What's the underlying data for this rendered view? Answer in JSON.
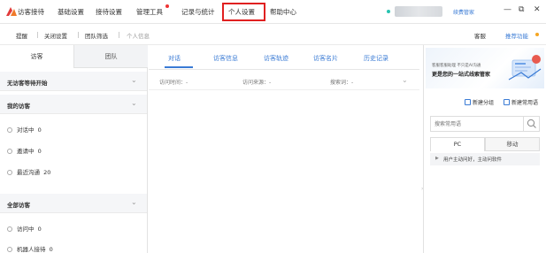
{
  "menu": {
    "items": [
      {
        "label": "访客接待"
      },
      {
        "label": "基础设置"
      },
      {
        "label": "接待设置"
      },
      {
        "label": "管理工具"
      },
      {
        "label": "记录与统计"
      },
      {
        "label": "个人设置"
      },
      {
        "label": "帮助中心"
      }
    ],
    "highlight_color": "#e02020",
    "notification_color": "#e33333"
  },
  "account": {
    "link": "续费管家",
    "status_color": "#29c3b0"
  },
  "window_controls": {
    "minimize": "—",
    "restore": "⧉",
    "close": "✕"
  },
  "toolbar": {
    "items": [
      {
        "label": "提醒"
      },
      {
        "label": "关闭设置"
      },
      {
        "label": "团队筛选"
      },
      {
        "label": "个人信息"
      }
    ],
    "right_plain": "客服",
    "right_link": "推荐功能"
  },
  "left_panel": {
    "tabs": [
      {
        "label": "访客"
      },
      {
        "label": "团队"
      }
    ],
    "groups": {
      "waiting": {
        "title": "无访客等待开始"
      },
      "mine": {
        "title": "我的访客",
        "items": [
          {
            "label": "对话中",
            "count": "0"
          },
          {
            "label": "邀请中",
            "count": "0"
          },
          {
            "label": "最近沟通",
            "count": "20"
          }
        ]
      },
      "all": {
        "title": "全部访客",
        "items": [
          {
            "label": "访问中",
            "count": "0"
          },
          {
            "label": "机器人接待",
            "count": "0"
          }
        ]
      }
    }
  },
  "center_panel": {
    "tabs": [
      {
        "label": "对话"
      },
      {
        "label": "访客信息"
      },
      {
        "label": "访客轨迹"
      },
      {
        "label": "访客名片"
      },
      {
        "label": "历史记录"
      }
    ],
    "filters": [
      {
        "label": "访问时间：-"
      },
      {
        "label": "访问来源：-"
      },
      {
        "label": "搜索词：-"
      }
    ],
    "accent_color": "#3a7bd5"
  },
  "right_panel": {
    "banner": {
      "small": "客服客服助理 不只是AI沟通",
      "headline": "更是您的一站式线索管家"
    },
    "actions": {
      "new_group": "新建分组",
      "new_phrase": "新建常用语"
    },
    "search": {
      "placeholder": "搜索常用语"
    },
    "segments": [
      {
        "label": "PC"
      },
      {
        "label": "移动"
      }
    ],
    "tree_item": "用户主动问好，主动问软件"
  }
}
